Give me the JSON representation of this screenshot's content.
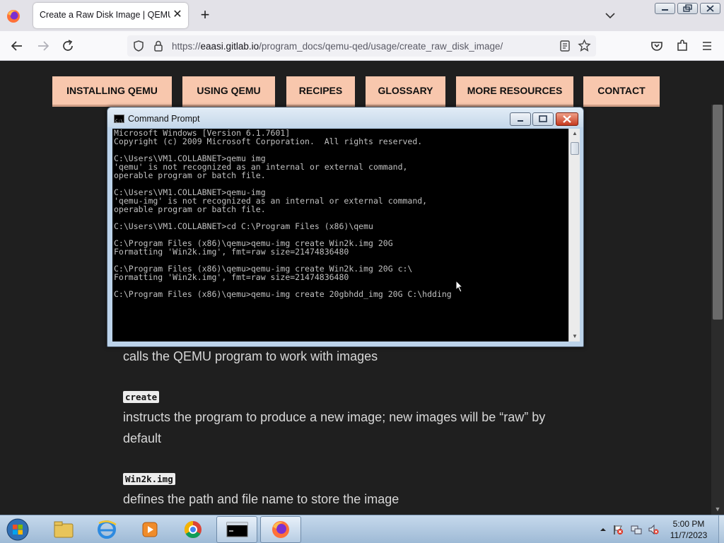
{
  "browser": {
    "tab_title": "Create a Raw Disk Image | QEMU QED",
    "tab_close": "✕",
    "new_tab": "+",
    "url_prefix": "https://",
    "url_host": "eaasi.gitlab.io",
    "url_path": "/program_docs/qemu-qed/usage/create_raw_disk_image/"
  },
  "site_nav": {
    "items": [
      "INSTALLING QEMU",
      "USING QEMU",
      "RECIPES",
      "GLOSSARY",
      "MORE RESOURCES",
      "CONTACT"
    ],
    "bg_color": "#f8c7ad"
  },
  "cmd_window": {
    "title": "Command Prompt",
    "lines": [
      "Microsoft Windows [Version 6.1.7601]",
      "Copyright (c) 2009 Microsoft Corporation.  All rights reserved.",
      "",
      "C:\\Users\\VM1.COLLABNET>qemu img",
      "'qemu' is not recognized as an internal or external command,",
      "operable program or batch file.",
      "",
      "C:\\Users\\VM1.COLLABNET>qemu-img",
      "'qemu-img' is not recognized as an internal or external command,",
      "operable program or batch file.",
      "",
      "C:\\Users\\VM1.COLLABNET>cd C:\\Program Files (x86)\\qemu",
      "",
      "C:\\Program Files (x86)\\qemu>qemu-img create Win2k.img 20G",
      "Formatting 'Win2k.img', fmt=raw size=21474836480",
      "",
      "C:\\Program Files (x86)\\qemu>qemu-img create Win2k.img 20G c:\\",
      "Formatting 'Win2k.img', fmt=raw size=21474836480",
      "",
      "C:\\Program Files (x86)\\qemu>qemu-img create 20gbhdd_img 20G C:\\hdding"
    ]
  },
  "article": {
    "para1": "calls the QEMU program to work with images",
    "chip_create": "create",
    "para2_line1": "instructs the program to produce a new image; new images will be “raw” by",
    "para2_line2": "default",
    "chip_win2k": "Win2k.img",
    "para3": "defines the path and file name to store the image"
  },
  "taskbar": {
    "items": [
      "windows-explorer",
      "internet-explorer",
      "windows-media-player",
      "chrome",
      "command-prompt",
      "firefox"
    ],
    "active_item": "command-prompt",
    "clock_time": "5:00 PM",
    "clock_date": "11/7/2023"
  }
}
